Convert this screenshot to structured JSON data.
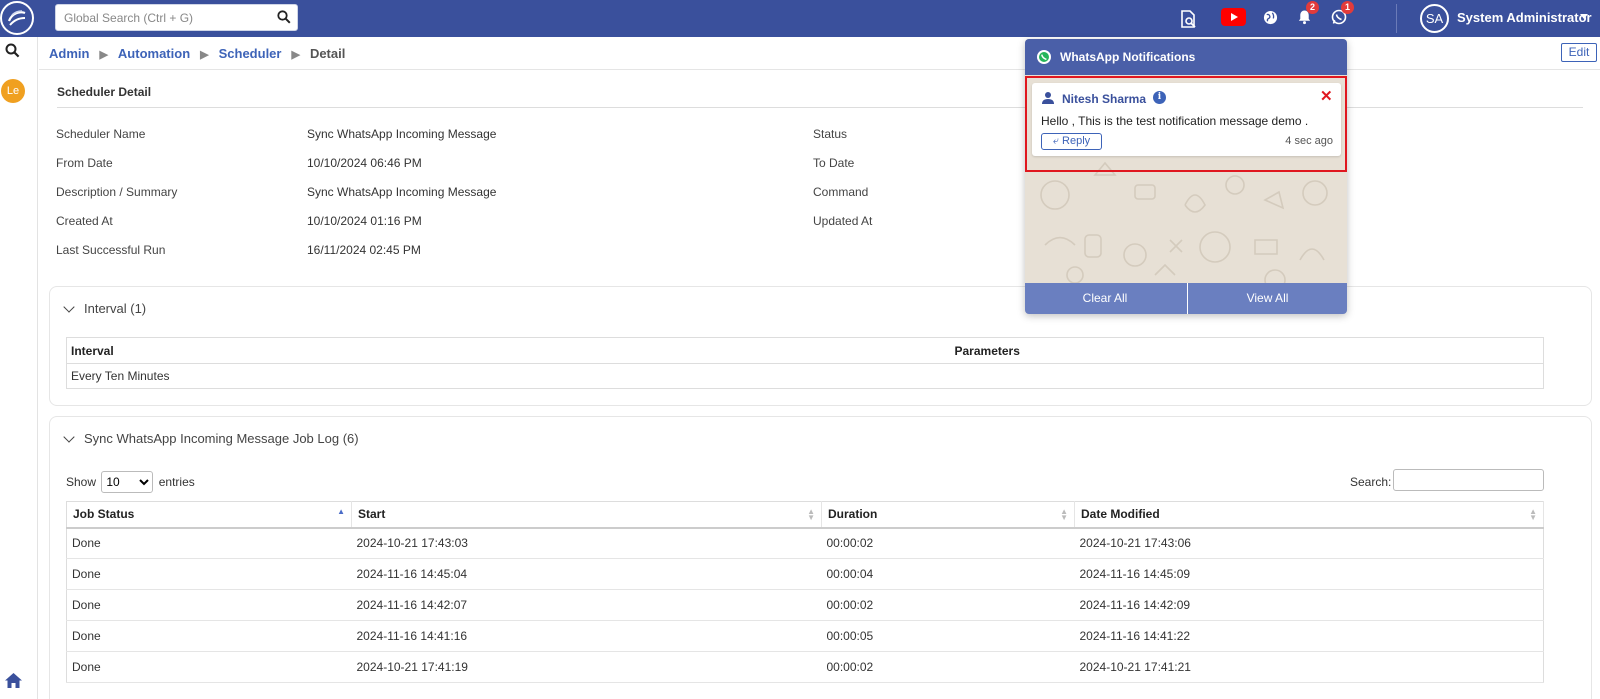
{
  "header": {
    "search_placeholder": "Global Search (Ctrl + G)",
    "notification_count": "2",
    "whatsapp_count": "1",
    "avatar_initials": "SA",
    "user_name": "System Administrator",
    "brand_color": "#3a509c"
  },
  "rail": {
    "le_label": "Le"
  },
  "breadcrumb": {
    "items": [
      "Admin",
      "Automation",
      "Scheduler"
    ],
    "current": "Detail",
    "edit_label": "Edit",
    "more_label": "..."
  },
  "detail": {
    "title": "Scheduler Detail",
    "left_fields": [
      {
        "label": "Scheduler Name",
        "value": "Sync WhatsApp Incoming Message"
      },
      {
        "label": "From Date",
        "value": "10/10/2024 06:46 PM"
      },
      {
        "label": "Description / Summary",
        "value": "Sync WhatsApp Incoming Message"
      },
      {
        "label": "Created At",
        "value": "10/10/2024 01:16 PM"
      },
      {
        "label": "Last Successful Run",
        "value": "16/11/2024 02:45 PM"
      }
    ],
    "right_labels": [
      "Status",
      "To Date",
      "Command",
      "Updated At"
    ]
  },
  "interval_panel": {
    "title": "Interval (1)",
    "columns": [
      "Interval",
      "Parameters"
    ],
    "rows": [
      [
        "Every Ten Minutes",
        ""
      ]
    ]
  },
  "joblog_panel": {
    "title": "Sync WhatsApp Incoming Message Job Log (6)",
    "show_label": "Show",
    "entries_label": "entries",
    "page_size": "10",
    "search_label": "Search:",
    "columns": [
      "Job Status",
      "Start",
      "Duration",
      "Date Modified"
    ],
    "rows": [
      [
        "Done",
        "2024-10-21 17:43:03",
        "00:00:02",
        "2024-10-21 17:43:06"
      ],
      [
        "Done",
        "2024-11-16 14:45:04",
        "00:00:04",
        "2024-11-16 14:45:09"
      ],
      [
        "Done",
        "2024-11-16 14:42:07",
        "00:00:02",
        "2024-11-16 14:42:09"
      ],
      [
        "Done",
        "2024-11-16 14:41:16",
        "00:00:05",
        "2024-11-16 14:41:22"
      ],
      [
        "Done",
        "2024-10-21 17:41:19",
        "00:00:02",
        "2024-10-21 17:41:21"
      ]
    ]
  },
  "whatsapp_popup": {
    "title": "WhatsApp Notifications",
    "sender": "Nitesh Sharma",
    "info_glyph": "i",
    "close_glyph": "✕",
    "message": "Hello , This is the test notification message demo .",
    "reply_label": "Reply",
    "time_ago": "4 sec ago",
    "clear_all_label": "Clear All",
    "view_all_label": "View All",
    "highlight_color": "#e0171f"
  }
}
